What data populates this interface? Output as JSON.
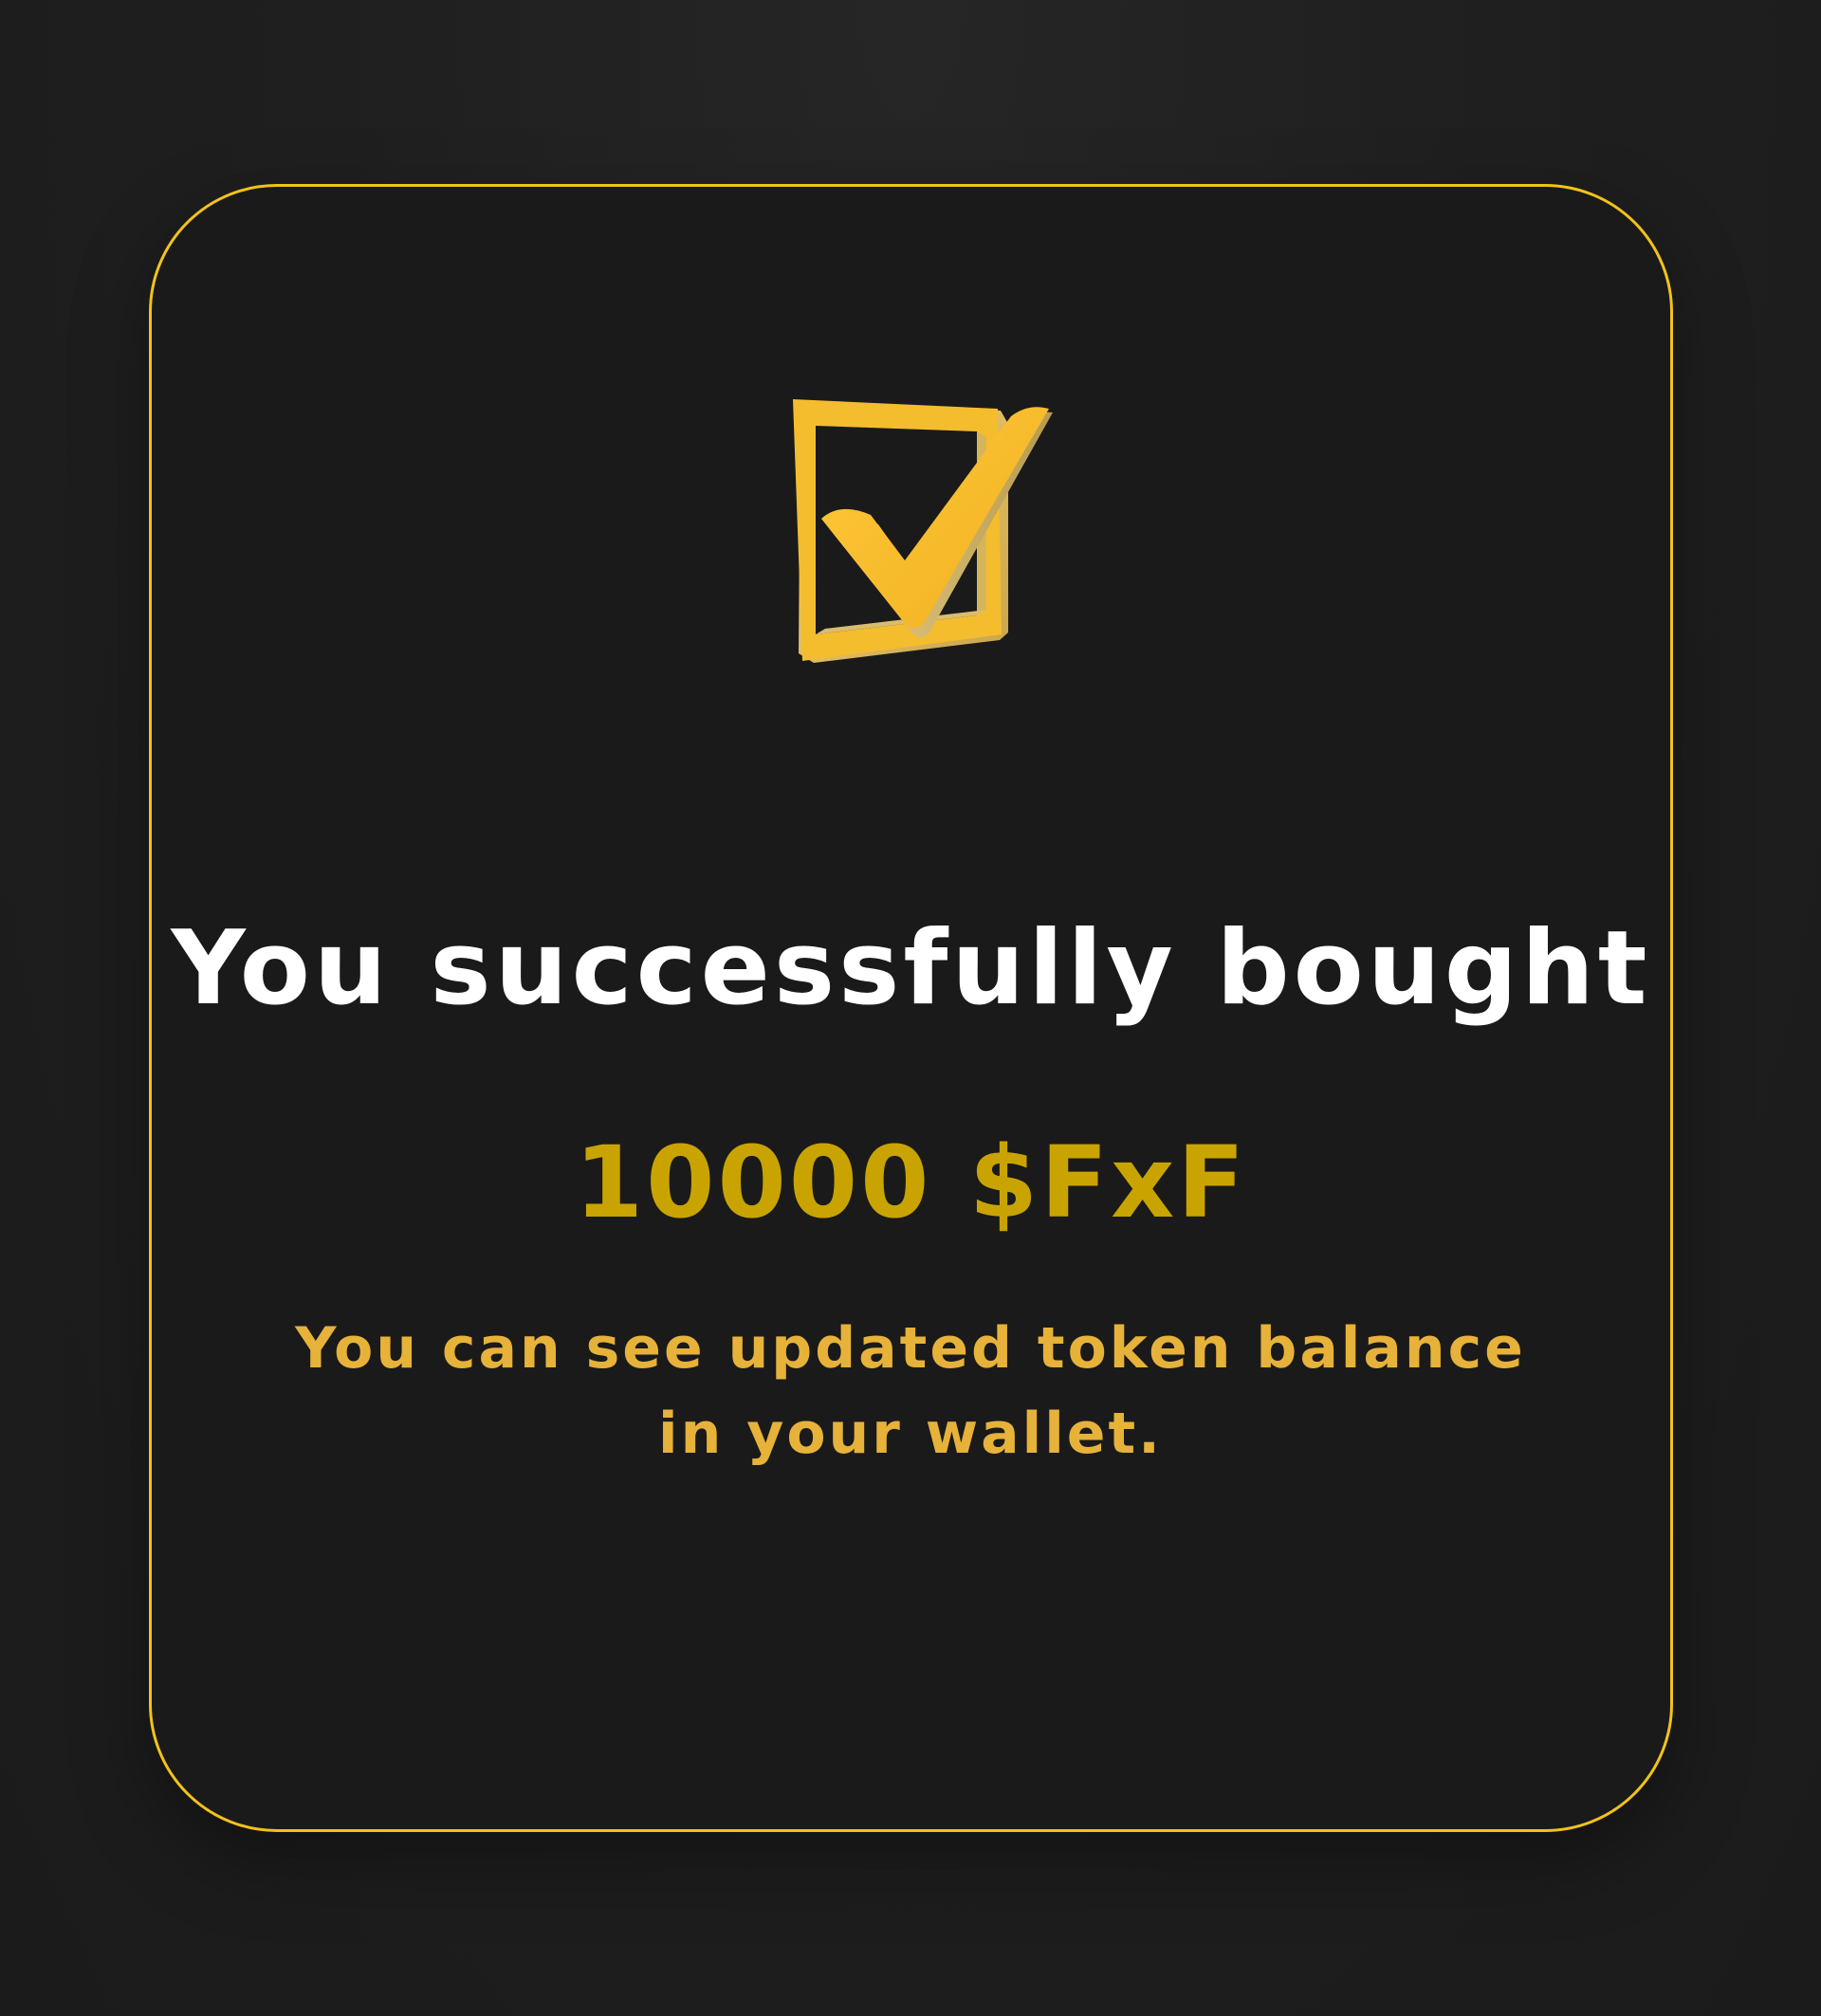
{
  "dialog": {
    "title": "You successfully bought",
    "amount": "10000 $FxF",
    "message": "You can see updated token balance in your wallet.",
    "icon": "check-box-icon",
    "colors": {
      "accent": "#f2c21b",
      "amount": "#c9a400",
      "message": "#e7b23a",
      "background": "#1a1a1a"
    }
  }
}
